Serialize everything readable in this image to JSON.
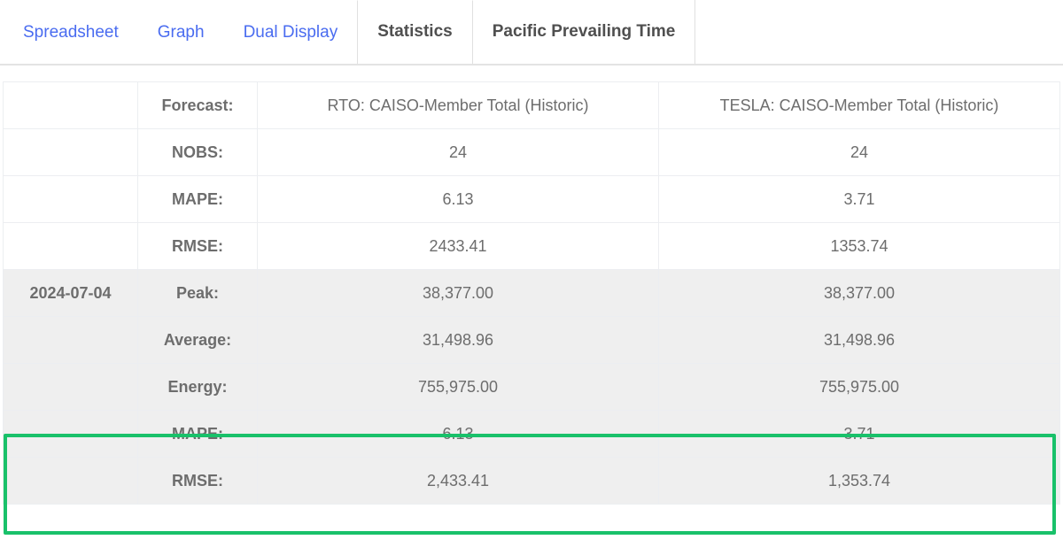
{
  "tabs": [
    {
      "label": "Spreadsheet",
      "state": "link"
    },
    {
      "label": "Graph",
      "state": "link"
    },
    {
      "label": "Dual Display",
      "state": "link"
    },
    {
      "label": "Statistics",
      "state": "active"
    },
    {
      "label": "Pacific Prevailing Time",
      "state": "boxed"
    }
  ],
  "table": {
    "header": {
      "date": "",
      "metric": "Forecast:",
      "col1": "RTO: CAISO-Member Total (Historic)",
      "col2": "TESLA: CAISO-Member Total (Historic)"
    },
    "rows": [
      {
        "date": "",
        "metric": "NOBS:",
        "col1": "24",
        "col2": "24",
        "shaded": false,
        "highlighted": false
      },
      {
        "date": "",
        "metric": "MAPE:",
        "col1": "6.13",
        "col2": "3.71",
        "shaded": false,
        "highlighted": false
      },
      {
        "date": "",
        "metric": "RMSE:",
        "col1": "2433.41",
        "col2": "1353.74",
        "shaded": false,
        "highlighted": false
      },
      {
        "date": "2024-07-04",
        "metric": "Peak:",
        "col1": "38,377.00",
        "col2": "38,377.00",
        "shaded": true,
        "highlighted": false
      },
      {
        "date": "",
        "metric": "Average:",
        "col1": "31,498.96",
        "col2": "31,498.96",
        "shaded": true,
        "highlighted": false
      },
      {
        "date": "",
        "metric": "Energy:",
        "col1": "755,975.00",
        "col2": "755,975.00",
        "shaded": true,
        "highlighted": false
      },
      {
        "date": "",
        "metric": "MAPE:",
        "col1": "6.13",
        "col2": "3.71",
        "shaded": true,
        "highlighted": true
      },
      {
        "date": "",
        "metric": "RMSE:",
        "col1": "2,433.41",
        "col2": "1,353.74",
        "shaded": true,
        "highlighted": true
      }
    ]
  },
  "colors": {
    "tab_link": "#4a6cf0",
    "tab_active_text": "#4f4f4f",
    "highlight_border": "#19c16a",
    "row_shaded_bg": "#efefef",
    "cell_text": "#6d6d6d"
  }
}
